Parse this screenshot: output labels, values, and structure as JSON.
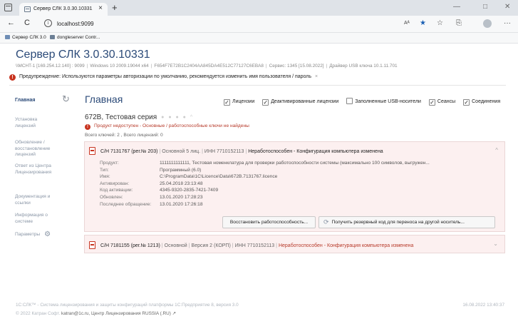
{
  "browser": {
    "tab_title": "Сервер СЛК 3.0.30.10331",
    "tab_close": "×",
    "new_tab": "+",
    "minimize": "—",
    "maximize": "□",
    "close": "✕",
    "back": "←",
    "reload": "C",
    "info": "i",
    "url": "localhost:9099",
    "reader": "Aᴬ",
    "star": "★",
    "collections": "☆",
    "wallet": "⎘",
    "more": "···",
    "favorites": [
      "Сервер СЛК 3.0",
      "dongleserver Contr..."
    ]
  },
  "header": {
    "title": "Сервер СЛК 3.0.30.10331",
    "server_info": [
      "\\\\MCHT-1 [169.254.12.140] : 9099",
      "Windows 10 2009.19044 x64",
      "F654F7E72B1C2404AA845DA4E512C77127C6EBA8",
      "Сервис: 1345 [15.08.2022]",
      "Драйвер USB ключа 10.1.11.701"
    ],
    "warning_label": "Предупреждение:",
    "warning_text": "Используются параметры авторизации по умолчанию, рекомендуется изменить имя пользователя / пароль",
    "warning_close": "×"
  },
  "sidebar": {
    "active": "Главная",
    "items": [
      {
        "label": "Установка лицензий"
      },
      {
        "label": "Обновление / восстановление лицензий"
      },
      {
        "label": "Ответ из Центра Лицензирования"
      },
      {
        "label": "Документация и ссылки"
      },
      {
        "label": "Информация о системе"
      },
      {
        "label": "Параметры"
      }
    ]
  },
  "main": {
    "title": "Главная",
    "filters": [
      {
        "label": "Лицензии",
        "checked": true
      },
      {
        "label": "Деактивированные лицензии",
        "checked": true
      },
      {
        "label": "Заполненные USB-носители",
        "checked": false
      },
      {
        "label": "Сеансы",
        "checked": true
      },
      {
        "label": "Соединения",
        "checked": true
      }
    ],
    "series_title": "672В, Тестовая серия",
    "series_error": "Продукт недоступен - Основные / работоспособные ключи не найдены",
    "keys_summary": "Всего ключей: 2 , Всего лицензий: 0"
  },
  "cards": [
    {
      "serial": "С/Н 7131767 (рег.№ 203)",
      "type": "Основной 5 лиц.",
      "inn": "ИНН 7710152113",
      "status": "Неработоспособен - Конфигурация компьютера изменена",
      "details": [
        {
          "label": "Продукт:",
          "value": "1111111111111, Тестовая номенклатура для проверки работоспособности системы (максимально 100 символов, выгружен..."
        },
        {
          "label": "Тип:",
          "value": "Программный (6.0)"
        },
        {
          "label": "Имя:",
          "value": "C:\\ProgramData\\1C\\Licence\\Data\\672B.7131767.licence"
        },
        {
          "label": "Активирован:",
          "value": "25.04.2018 23:13:48"
        },
        {
          "label": "Код активации:",
          "value": "4345-9320-2835-7421-7409"
        },
        {
          "label": "Обновлен:",
          "value": "13.01.2020 17:28:23"
        },
        {
          "label": "Последнее обращение:",
          "value": "13.01.2020 17:26:18"
        }
      ],
      "btn_restore": "Восстановить работоспособность...",
      "btn_backup": "Получить резервный код для переноса на другой носитель..."
    },
    {
      "serial": "С/Н 7181155 (рег.№ 1213)",
      "type": "Основной",
      "version": "Версия 2 (КОРП)",
      "inn": "ИНН 7710152113",
      "status": "Неработоспособен - Конфигурация компьютера изменена"
    }
  ],
  "footer": {
    "line1": "1С:СЛК™ - Система лицензирования и защиты конфигураций платформы 1С:Предприятие 8, версия 3.0",
    "date": "16.08.2022 13:40:37",
    "copyright": "© 2022 Катран Софт.",
    "email": "katran@1c.ru,",
    "center": "Центр Лицензирования RUSSIA (.RU)",
    "ext_icon": "↗"
  }
}
